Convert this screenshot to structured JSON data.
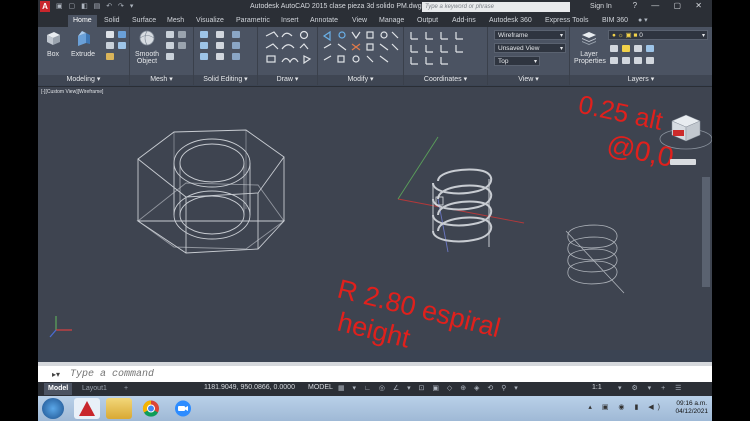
{
  "app": {
    "logo_letter": "A",
    "title": "Autodesk AutoCAD 2015     clase pieza 3d solido PM.dwg",
    "search_placeholder": "Type a keyword or phrase",
    "signin_label": "Sign In"
  },
  "ribbon_tabs": [
    "Home",
    "Solid",
    "Surface",
    "Mesh",
    "Visualize",
    "Parametric",
    "Insert",
    "Annotate",
    "View",
    "Manage",
    "Output",
    "Add-ins",
    "Autodesk 360",
    "Express Tools",
    "BIM 360"
  ],
  "ribbon": {
    "modeling": {
      "title": "Modeling",
      "box_label": "Box",
      "extrude_label": "Extrude"
    },
    "mesh": {
      "title": "Mesh",
      "smooth_label_1": "Smooth",
      "smooth_label_2": "Object"
    },
    "solid_editing": {
      "title": "Solid Editing"
    },
    "draw": {
      "title": "Draw"
    },
    "modify": {
      "title": "Modify"
    },
    "coordinates": {
      "title": "Coordinates"
    },
    "view": {
      "title": "View",
      "visual_style": "Wireframe",
      "named_view": "Unsaved View",
      "view_direction": "Top"
    },
    "layers": {
      "title": "Layers",
      "layer_props_1": "Layer",
      "layer_props_2": "Properties",
      "current_layer": "0"
    }
  },
  "viewport": {
    "label": "[-][Custom View][Wireframe]",
    "annotation_top": "0.25 alt",
    "annotation_top2": "@0,0",
    "annotation_bottom1": "R 2.80 espiral",
    "annotation_bottom2": "height"
  },
  "command": {
    "placeholder": "Type a command"
  },
  "status": {
    "layout_tabs": [
      "Model",
      "Layout1"
    ],
    "add_tab": "+",
    "coordinates": "1181.9049, 950.0866, 0.0000",
    "model_label": "MODEL",
    "scale": "1:1"
  },
  "taskbar": {
    "time": "09:16 a.m.",
    "date": "04/12/2021"
  },
  "colors": {
    "accent_red": "#e0201c",
    "wire": "#c8ccd2"
  }
}
